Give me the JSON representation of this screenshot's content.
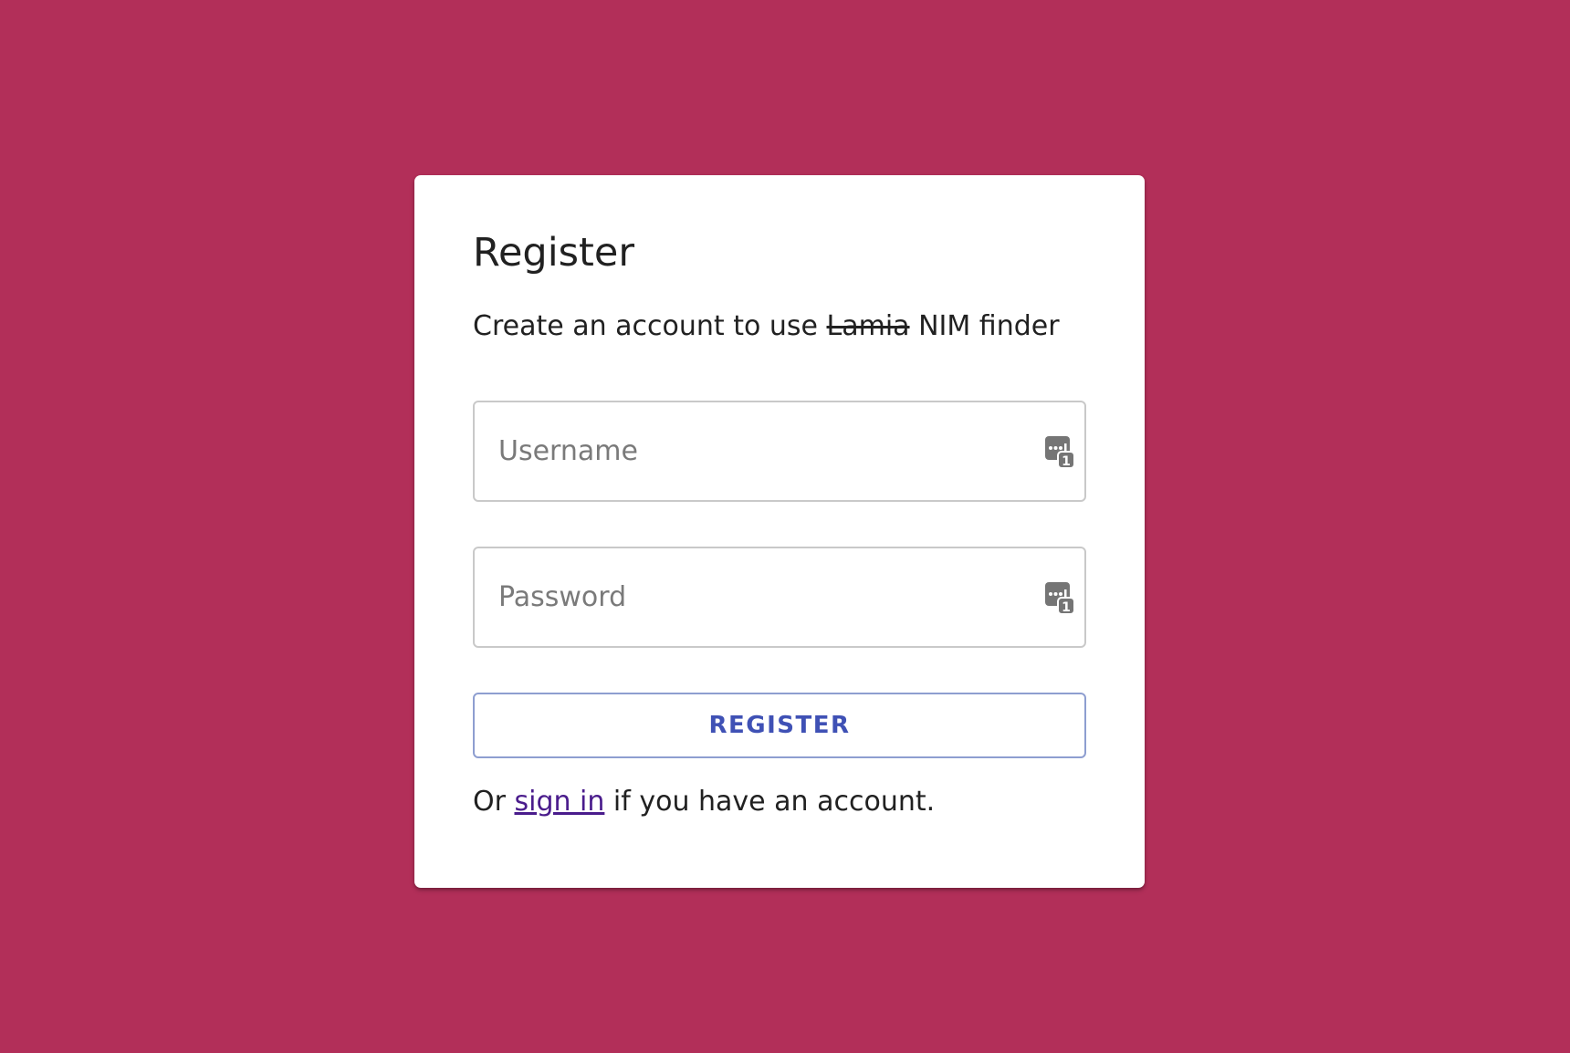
{
  "colors": {
    "background": "#b22f59",
    "card": "#ffffff",
    "accent": "#3f51b5",
    "link": "#4a1c8c"
  },
  "form": {
    "title": "Register",
    "subtitle_prefix": "Create an account to use ",
    "subtitle_struck": "Lamia",
    "subtitle_suffix": " NIM finder",
    "username": {
      "placeholder": "Username",
      "value": "",
      "icon": "password-manager-icon"
    },
    "password": {
      "placeholder": "Password",
      "value": "",
      "icon": "password-manager-icon"
    },
    "submit_label": "REGISTER",
    "footer_prefix": "Or ",
    "footer_link": "sign in",
    "footer_suffix": " if you have an account."
  }
}
